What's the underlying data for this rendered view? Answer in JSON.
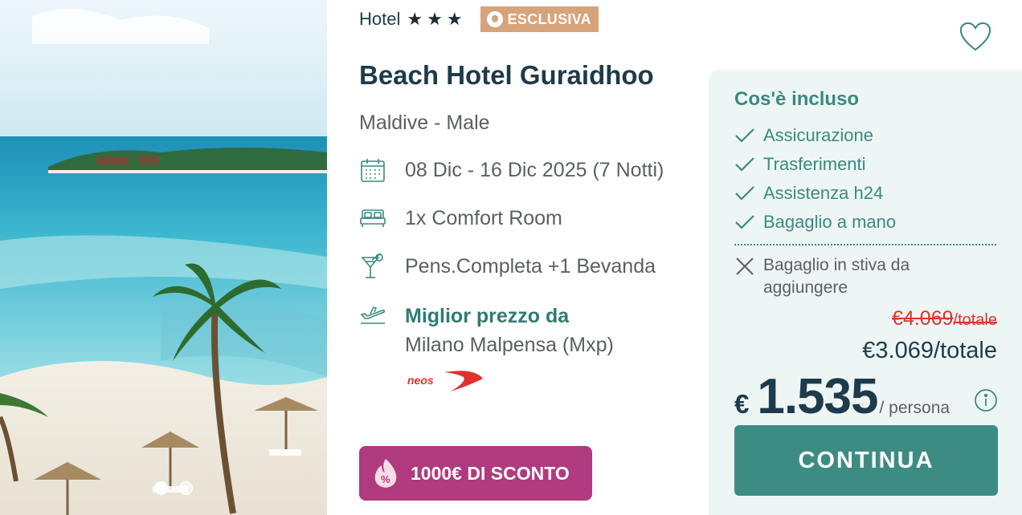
{
  "hotel": {
    "category_label": "Hotel",
    "stars": 3,
    "star_glyph": "★",
    "badge_label": "ESCLUSIVA",
    "name": "Beach Hotel Guraidhoo",
    "location": "Maldive - Male"
  },
  "details": {
    "dates": "08 Dic - 16 Dic 2025 (7 Notti)",
    "room": "1x Comfort Room",
    "board": "Pens.Completa +1 Bevanda",
    "best_price_title": "Miglior prezzo da",
    "departure_airport": "Milano Malpensa (Mxp)",
    "airline_logo_text": "neos"
  },
  "promo": {
    "label": "1000€ DI SCONTO"
  },
  "gallery": {
    "dots": 2,
    "active_dot": 0
  },
  "included": {
    "title": "Cos'è incluso",
    "items": [
      "Assicurazione",
      "Trasferimenti",
      "Assistenza h24",
      "Bagaglio a mano"
    ],
    "excluded": [
      "Bagaglio in stiva da aggiungere"
    ]
  },
  "pricing": {
    "old_total": "€4.069",
    "old_total_unit": "/totale",
    "total": "€3.069/totale",
    "currency": "€",
    "per_person": "1.535",
    "per_person_unit": "/ persona",
    "cta_label": "CONTINUA"
  },
  "colors": {
    "brand_teal": "#3d8c84",
    "text_teal": "#3a8a80",
    "dark_text": "#1d3b4a",
    "badge_tan": "#d6a37b",
    "promo_magenta": "#b03a7e",
    "strike_red": "#d9362e",
    "box_bg": "#eef6f5"
  },
  "icons": {
    "dates": "calendar-icon",
    "room": "bed-icon",
    "board": "cocktail-icon",
    "flight": "airplane-takeoff-icon",
    "favorite": "heart-icon",
    "check": "check-icon",
    "excluded": "cross-icon",
    "info": "info-icon",
    "promo": "discount-fire-icon"
  }
}
